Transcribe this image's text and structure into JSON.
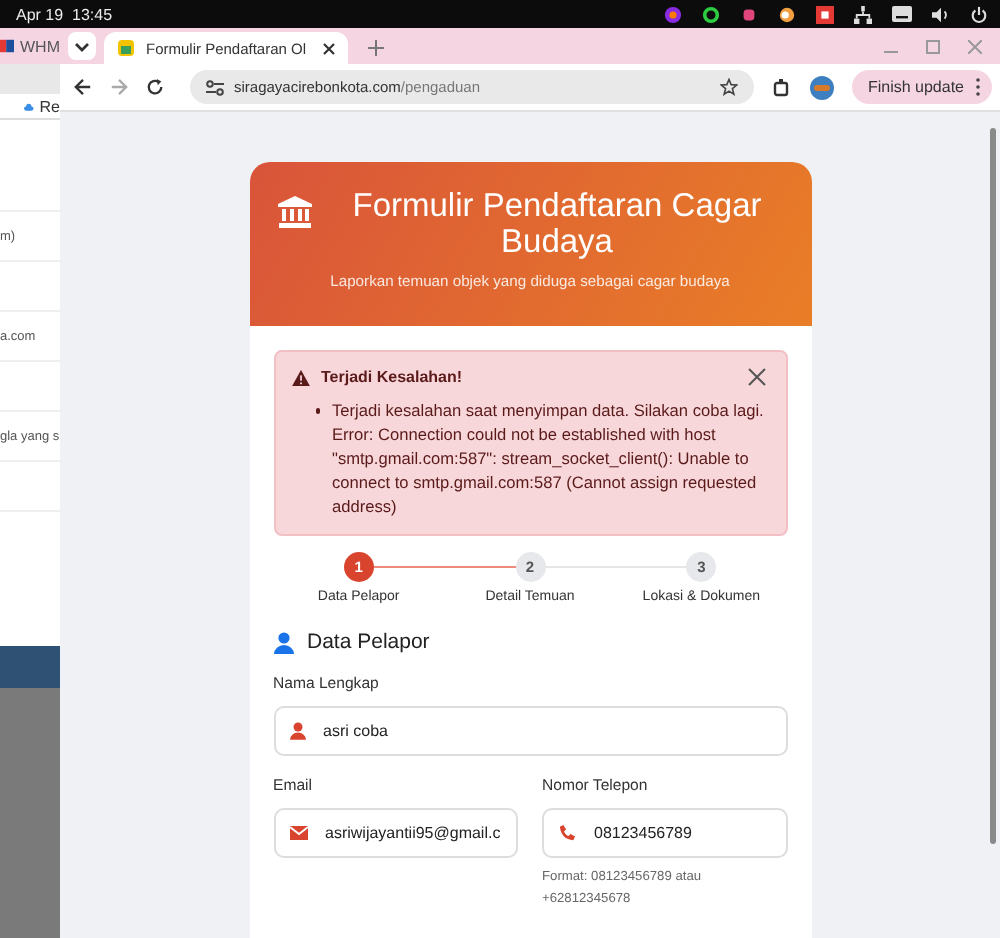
{
  "top_bar": {
    "date": "Apr 19",
    "time": "13:45"
  },
  "background_window": {
    "tab": "WHM",
    "bookmark": "Re",
    "fragments": [
      "m)",
      "a.com",
      "gla yang s"
    ]
  },
  "browser": {
    "tabs": [
      {
        "label": "Formulir Pendaftaran Ol",
        "selected": true
      }
    ],
    "url_host": "siragayacirebonkota.com",
    "url_path": "/pengaduan",
    "update_button": "Finish update"
  },
  "form": {
    "title": "Formulir Pendaftaran Cagar Budaya",
    "subtitle": "Laporkan temuan objek yang diduga sebagai cagar budaya",
    "alert": {
      "title": "Terjadi Kesalahan!",
      "messages": [
        "Terjadi kesalahan saat menyimpan data. Silakan coba lagi. Error: Connection could not be established with host \"smtp.gmail.com:587\": stream_socket_client(): Unable to connect to smtp.gmail.com:587 (Cannot assign requested address)"
      ]
    },
    "steps": [
      {
        "number": "1",
        "label": "Data Pelapor",
        "selected": true
      },
      {
        "number": "2",
        "label": "Detail Temuan",
        "selected": false
      },
      {
        "number": "3",
        "label": "Lokasi & Dokumen",
        "selected": false
      }
    ],
    "section_title": "Data Pelapor",
    "fields": [
      {
        "kind": "name",
        "label": "Nama Lengkap",
        "value": "asri coba"
      },
      {
        "kind": "email",
        "label": "Email",
        "value": "asriwijayantii95@gmail.c"
      },
      {
        "kind": "phone",
        "label": "Nomor Telepon",
        "value": "08123456789",
        "hint": "Format: 08123456789 atau +62812345678"
      }
    ]
  }
}
